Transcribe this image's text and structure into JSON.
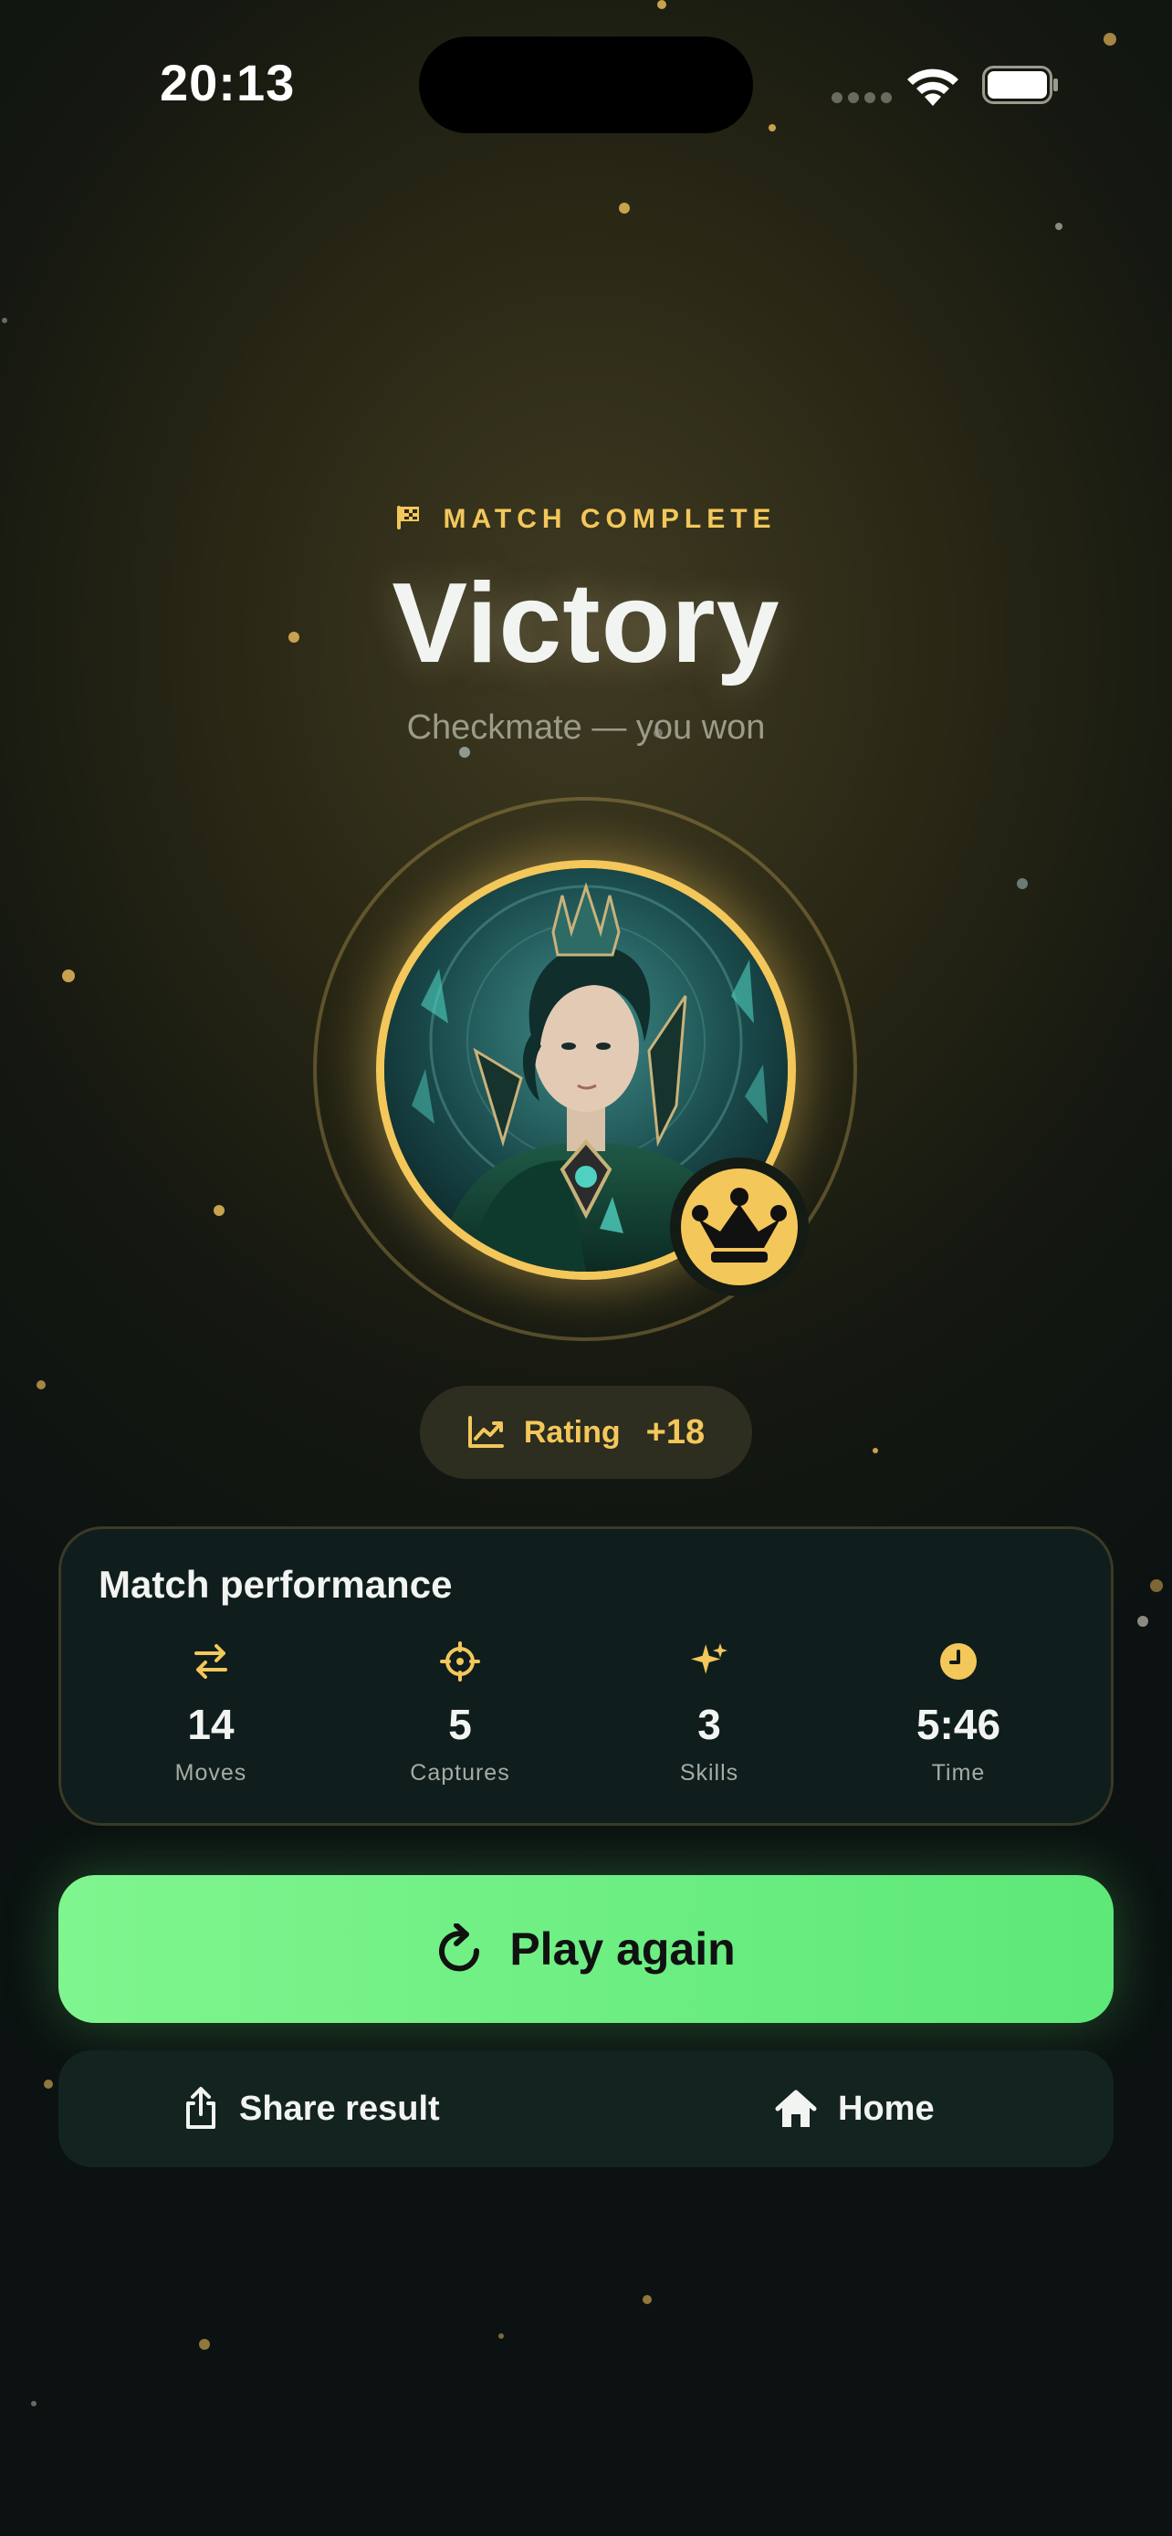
{
  "status_bar": {
    "time": "20:13"
  },
  "header": {
    "kicker": "MATCH COMPLETE",
    "title": "Victory",
    "subtitle": "Checkmate — you won"
  },
  "avatar": {
    "badge_icon": "crown-icon"
  },
  "rating": {
    "label": "Rating",
    "delta": "+18",
    "icon": "trend-up-icon"
  },
  "performance": {
    "title": "Match performance",
    "stats": [
      {
        "icon": "swap-arrows-icon",
        "value": "14",
        "label": "Moves"
      },
      {
        "icon": "crosshair-icon",
        "value": "5",
        "label": "Captures"
      },
      {
        "icon": "sparkle-icon",
        "value": "3",
        "label": "Skills"
      },
      {
        "icon": "clock-icon",
        "value": "5:46",
        "label": "Time"
      }
    ]
  },
  "actions": {
    "play_again": "Play again",
    "share": "Share result",
    "home": "Home"
  },
  "colors": {
    "accent_gold": "#f3c75a",
    "primary_green": "#6bef82",
    "card_bg": "#0f1e1c"
  }
}
